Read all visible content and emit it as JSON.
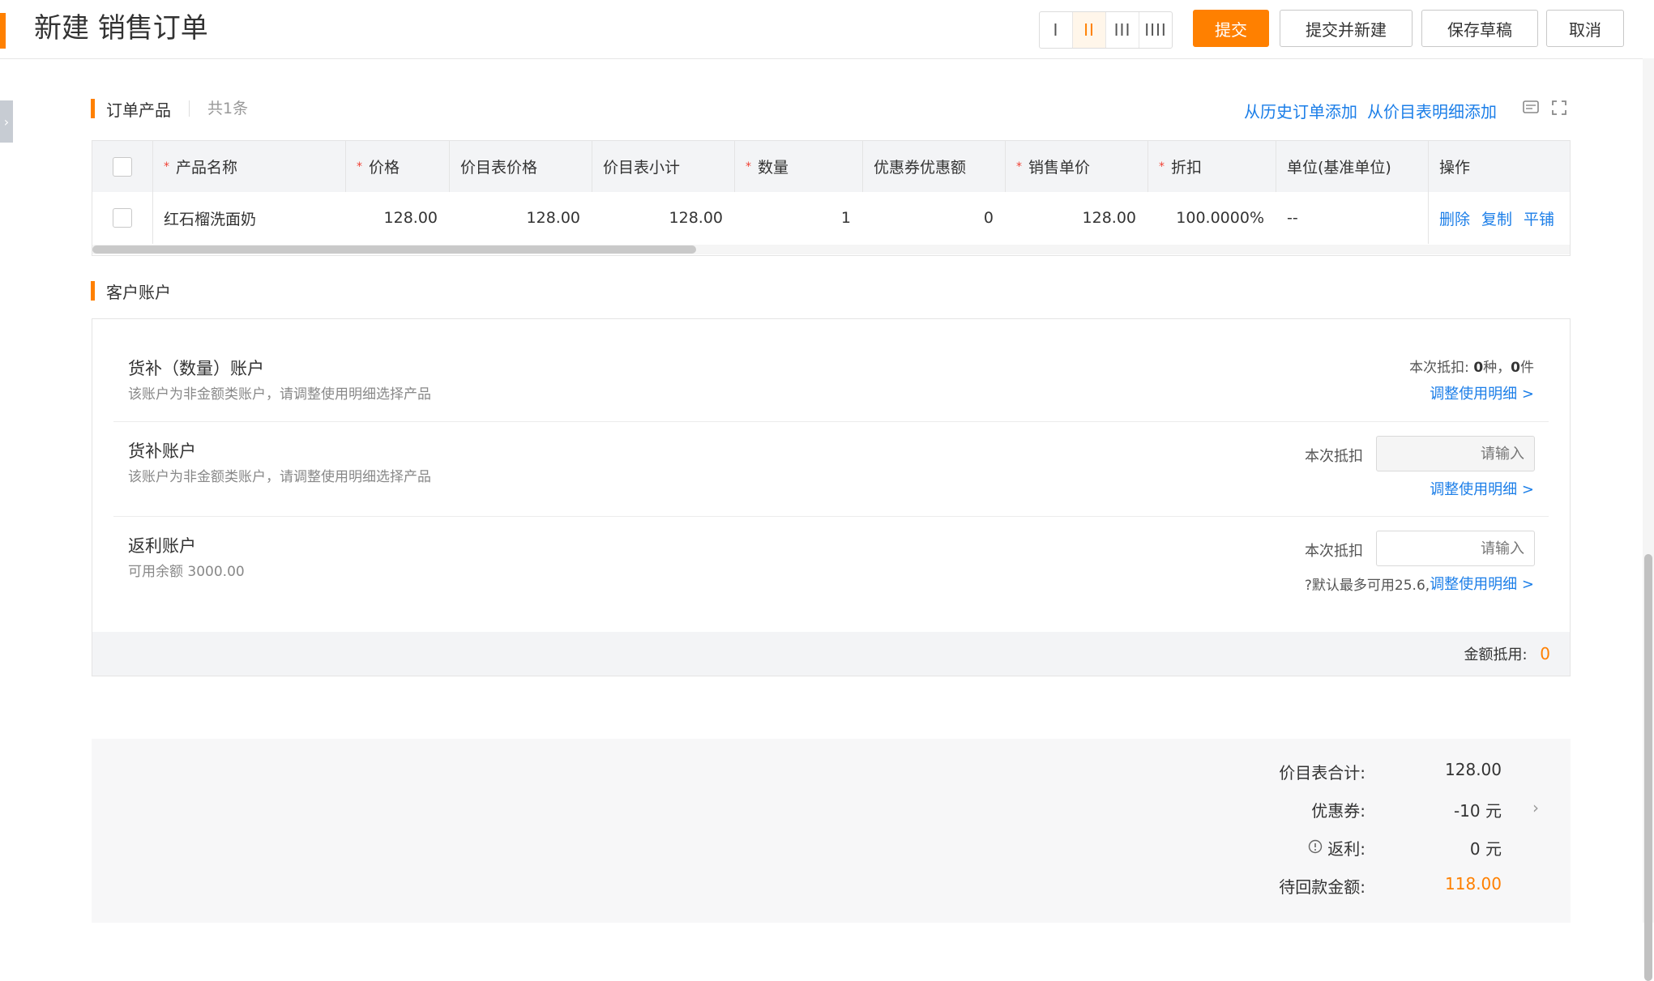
{
  "header": {
    "title": "新建 销售订单",
    "column_switch": [
      "I",
      "II",
      "III",
      "IIII"
    ],
    "column_switch_active": 1,
    "buttons": {
      "submit": "提交",
      "submit_new": "提交并新建",
      "save_draft": "保存草稿",
      "cancel": "取消"
    }
  },
  "products": {
    "title": "订单产品",
    "count": "共1条",
    "link_history": "从历史订单添加",
    "link_pricelist": "从价目表明细添加",
    "columns": [
      "产品名称",
      "价格",
      "价目表价格",
      "价目表小计",
      "数量",
      "优惠券优惠额",
      "销售单价",
      "折扣",
      "单位(基准单位)",
      "操作"
    ],
    "rows": [
      {
        "name": "红石榴洗面奶",
        "price": "128.00",
        "list_price": "128.00",
        "list_subtotal": "128.00",
        "qty": "1",
        "coupon": "0",
        "unit_price": "128.00",
        "discount": "100.0000%",
        "unit": "--",
        "actions": [
          "删除",
          "复制",
          "平铺"
        ]
      }
    ]
  },
  "account": {
    "title": "客户账户",
    "items": [
      {
        "name": "货补（数量）账户",
        "desc": "该账户为非金额类账户，请调整使用明细选择产品",
        "deduct_label": "本次抵扣:",
        "deduct_kinds": "0",
        "deduct_kinds_unit": "种，",
        "deduct_pieces": "0",
        "deduct_pieces_unit": "件",
        "adjust_link": "调整使用明细 >"
      },
      {
        "name": "货补账户",
        "desc": "该账户为非金额类账户，请调整使用明细选择产品",
        "deduct_label": "本次抵扣",
        "placeholder": "请输入",
        "adjust_link": "调整使用明细 >"
      },
      {
        "name": "返利账户",
        "desc": "可用余额 3000.00",
        "deduct_label": "本次抵扣",
        "placeholder": "请输入",
        "hint": "?默认最多可用25.6,",
        "adjust_link": "调整使用明细 >"
      }
    ],
    "footer_label": "金额抵用:",
    "footer_value": "0"
  },
  "summary": {
    "list_total_label": "价目表合计:",
    "list_total_value": "128.00",
    "coupon_label": "优惠券:",
    "coupon_value": "-10 元",
    "rebate_label": "返利:",
    "rebate_value": "0 元",
    "due_label": "待回款金额:",
    "due_value": "118.00"
  },
  "colors": {
    "accent": "#ff8000",
    "link": "#1b7ee8",
    "required": "#f04134"
  },
  "icons": [
    "side-expand-icon",
    "table-settings-icon",
    "fullscreen-icon",
    "chevron-right-icon",
    "info-icon",
    "question-icon"
  ]
}
